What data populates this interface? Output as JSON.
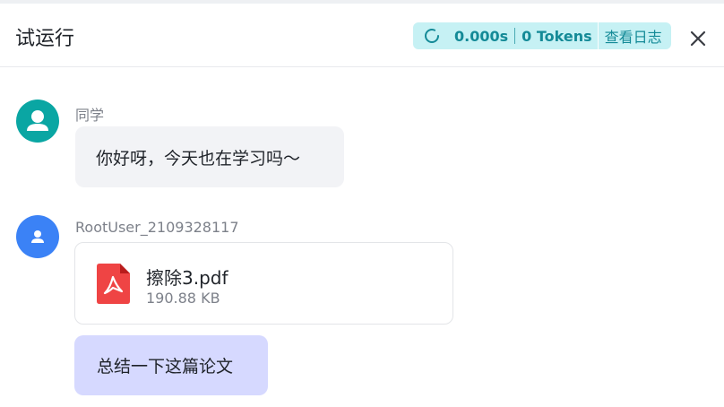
{
  "header": {
    "title": "试运行",
    "run_time": "0.000s",
    "tokens": "0 Tokens",
    "log_label": "查看日志"
  },
  "colors": {
    "accent_teal": "#0aa6a3",
    "avatar_blue": "#3b82f6",
    "pill_bg": "#c6f1f4",
    "pill_text": "#148a97",
    "assistant_bubble": "#f2f3f6",
    "user_bubble": "#d6d9ff",
    "pdf_red": "#ef4444"
  },
  "messages": [
    {
      "sender": "同学",
      "avatar_icon": "person-icon",
      "text": "你好呀，今天也在学习吗～"
    },
    {
      "sender": "RootUser_2109328117",
      "avatar_icon": "person-icon",
      "file": {
        "name": "擦除3.pdf",
        "size": "190.88 KB",
        "icon": "pdf-icon"
      },
      "text": "总结一下这篇论文"
    }
  ]
}
